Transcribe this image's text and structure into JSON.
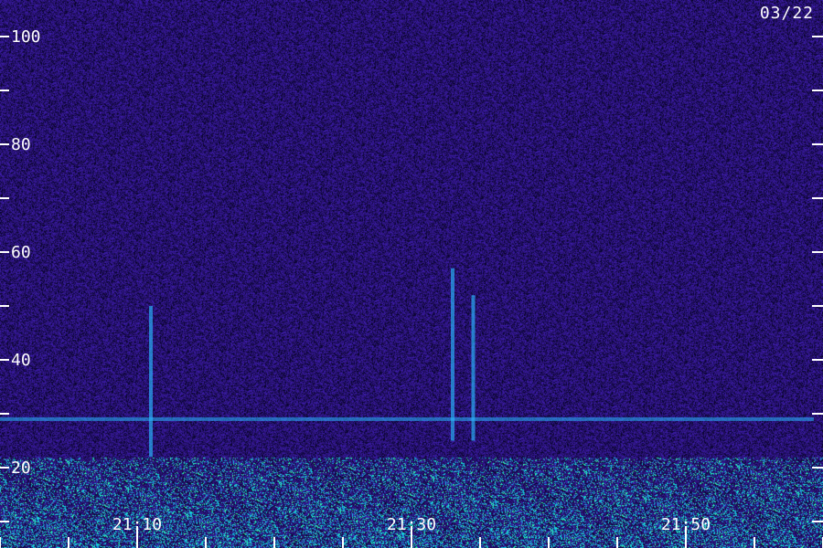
{
  "date_label": "03/22",
  "colors": {
    "background": "#2c1470",
    "noise_dark": "#140838",
    "noise_light": "#3e1fa6",
    "signal_cyan": "#29b8ff",
    "signal_green": "#3dff9e",
    "axis": "#ffffff"
  },
  "chart_data": {
    "type": "heatmap",
    "title": "",
    "xlabel": "",
    "ylabel": "",
    "y_ticks": [
      "100",
      "80",
      "60",
      "40",
      "20"
    ],
    "y_tick_values": [
      100,
      80,
      60,
      40,
      20
    ],
    "y_minor_ticks": [
      10,
      30,
      50,
      70,
      90
    ],
    "ylim": [
      10,
      105
    ],
    "x_ticks": [
      "21:10",
      "21:30",
      "21:50"
    ],
    "x_tick_values": [
      10,
      30,
      50
    ],
    "xlim": [
      0,
      60
    ],
    "x_minor_tick_step": 5,
    "features": {
      "continuous_band_y": 29,
      "low_frequency_noise_band": [
        10,
        22
      ],
      "vertical_bursts": [
        {
          "x": 11,
          "y_from": 22,
          "y_to": 50
        },
        {
          "x": 33,
          "y_from": 25,
          "y_to": 57
        },
        {
          "x": 34.5,
          "y_from": 25,
          "y_to": 52
        }
      ]
    }
  }
}
